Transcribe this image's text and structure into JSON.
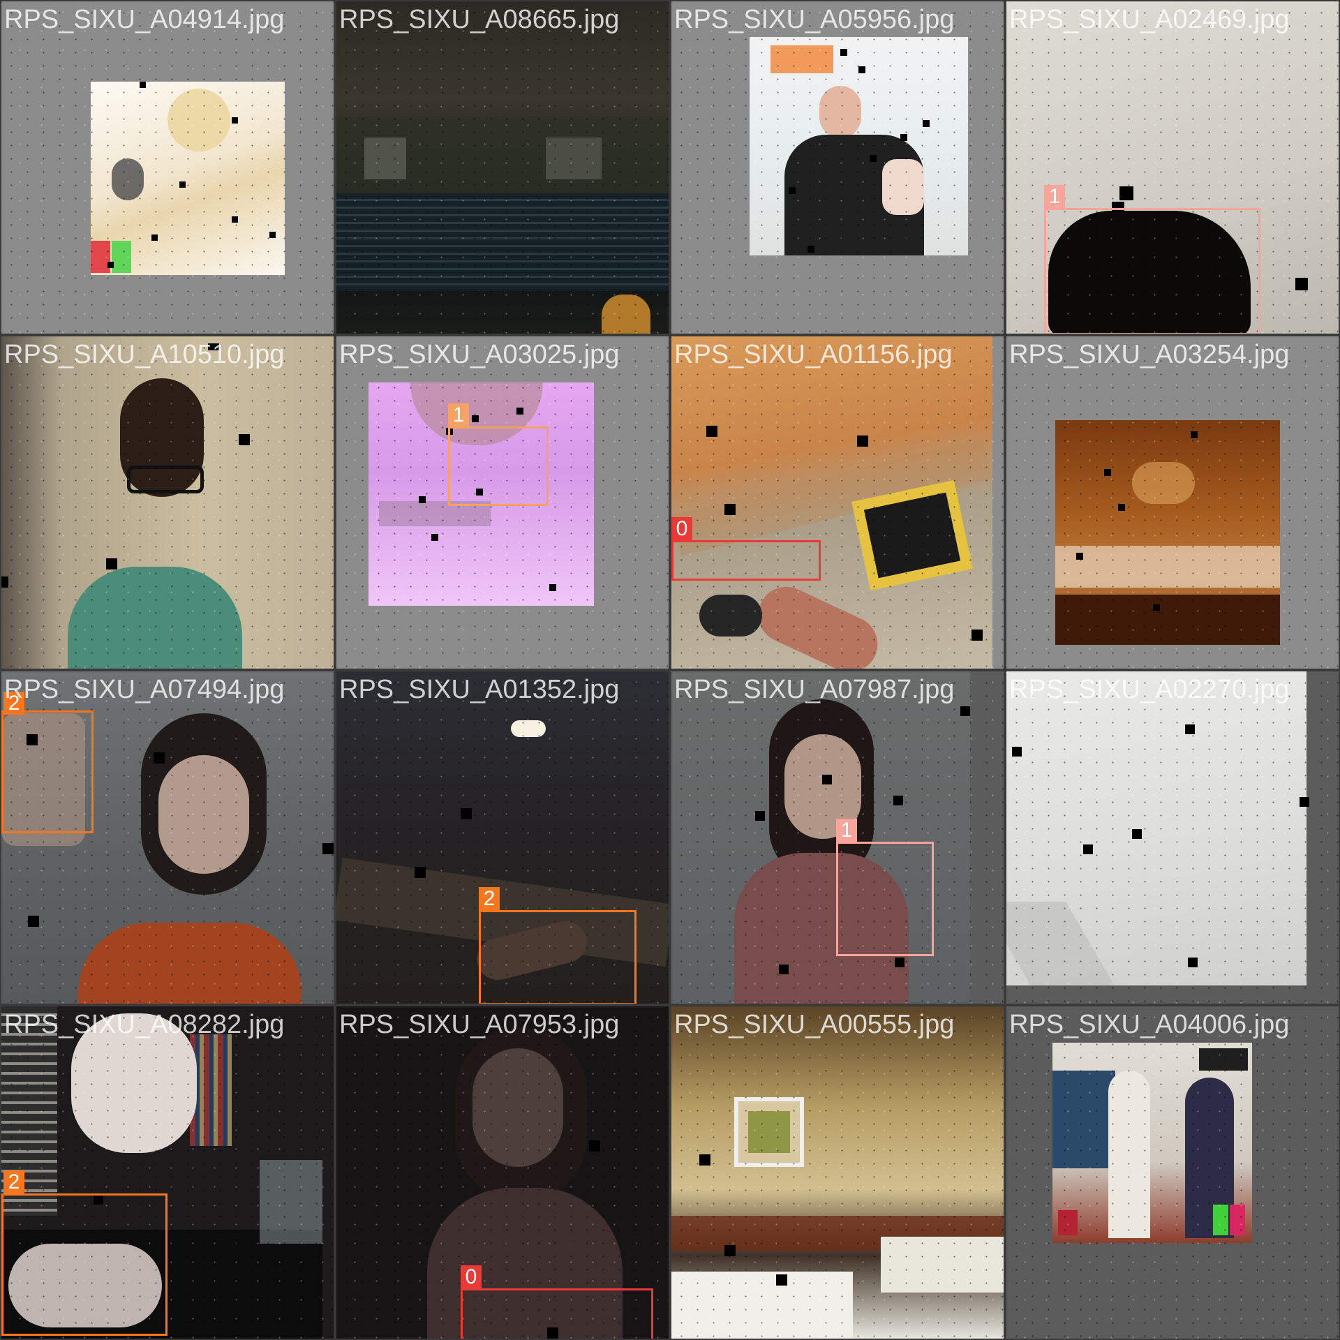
{
  "tiles": [
    {
      "name": "RPS_SIXU_A04914.jpg",
      "boxes": []
    },
    {
      "name": "RPS_SIXU_A08665.jpg",
      "boxes": []
    },
    {
      "name": "RPS_SIXU_A05956.jpg",
      "boxes": []
    },
    {
      "name": "RPS_SIXU_A02469.jpg",
      "boxes": [
        {
          "label": "1",
          "color": "#f7a49a"
        }
      ]
    },
    {
      "name": "RPS_SIXU_A10510.jpg",
      "boxes": []
    },
    {
      "name": "RPS_SIXU_A03025.jpg",
      "boxes": [
        {
          "label": "1",
          "color": "#f5a263"
        }
      ]
    },
    {
      "name": "RPS_SIXU_A01156.jpg",
      "boxes": [
        {
          "label": "0",
          "color": "#ea3a35"
        }
      ]
    },
    {
      "name": "RPS_SIXU_A03254.jpg",
      "boxes": []
    },
    {
      "name": "RPS_SIXU_A07494.jpg",
      "boxes": [
        {
          "label": "2",
          "color": "#f5761f"
        }
      ]
    },
    {
      "name": "RPS_SIXU_A01352.jpg",
      "boxes": [
        {
          "label": "2",
          "color": "#f5761f"
        }
      ]
    },
    {
      "name": "RPS_SIXU_A07987.jpg",
      "boxes": [
        {
          "label": "1",
          "color": "#f7a49a"
        }
      ]
    },
    {
      "name": "RPS_SIXU_A02270.jpg",
      "boxes": []
    },
    {
      "name": "RPS_SIXU_A08282.jpg",
      "boxes": [
        {
          "label": "2",
          "color": "#f5761f"
        }
      ]
    },
    {
      "name": "RPS_SIXU_A07953.jpg",
      "boxes": [
        {
          "label": "0",
          "color": "#ea3a35"
        }
      ]
    },
    {
      "name": "RPS_SIXU_A00555.jpg",
      "boxes": []
    },
    {
      "name": "RPS_SIXU_A04006.jpg",
      "boxes": []
    }
  ]
}
